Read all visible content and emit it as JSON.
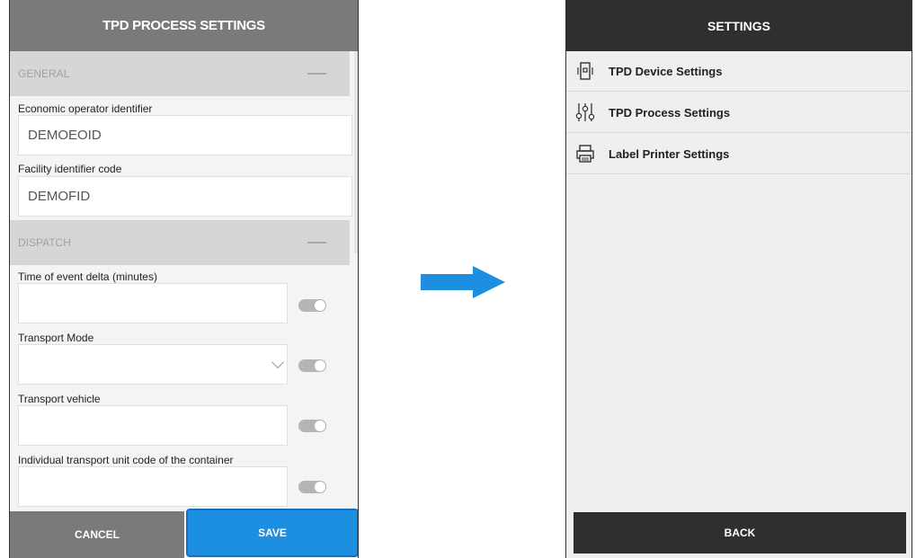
{
  "left": {
    "header_title": "TPD PROCESS SETTINGS",
    "general": {
      "title": "GENERAL",
      "fields": [
        {
          "label": "Economic operator identifier",
          "value": "DEMOEOID"
        },
        {
          "label": "Facility identifier code",
          "value": "DEMOFID"
        }
      ]
    },
    "dispatch": {
      "title": "DISPATCH",
      "fields": [
        {
          "label": "Time of event delta (minutes)",
          "value": ""
        },
        {
          "label": "Transport Mode",
          "value": ""
        },
        {
          "label": "Transport vehicle",
          "value": ""
        },
        {
          "label": "Individual transport unit code of the container",
          "value": ""
        }
      ]
    },
    "cancel_label": "CANCEL",
    "save_label": "SAVE"
  },
  "right": {
    "header_title": "SETTINGS",
    "menu": [
      {
        "label": "TPD Device Settings",
        "icon": "device-icon"
      },
      {
        "label": "TPD Process Settings",
        "icon": "sliders-icon"
      },
      {
        "label": "Label Printer Settings",
        "icon": "printer-icon"
      }
    ],
    "back_label": "BACK"
  },
  "colors": {
    "save_blue": "#1d8fe0",
    "arrow_blue": "#1e8fe0",
    "grey_header": "#7a7a7a",
    "dark_header": "#2f2f2f"
  }
}
